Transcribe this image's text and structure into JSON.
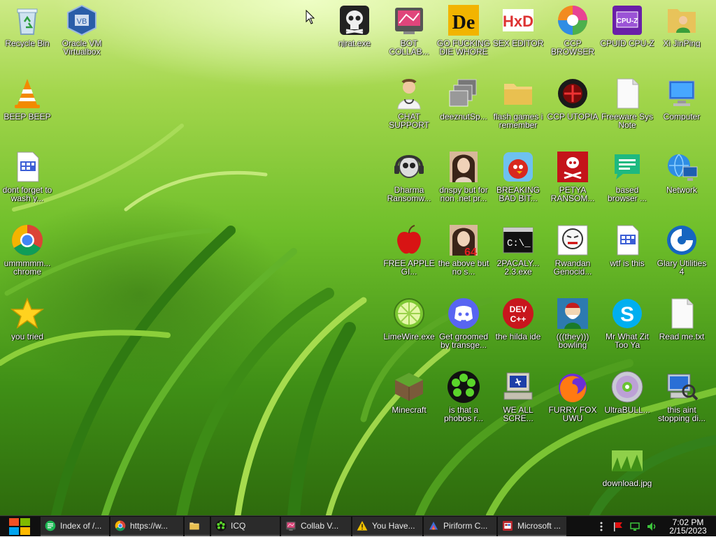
{
  "desktop": {
    "icons": [
      {
        "id": "recycle-bin",
        "label": "Recycle Bin",
        "icon": "recycle-bin-icon"
      },
      {
        "id": "oracle-vm",
        "label": "Oracle VM Virtualbox",
        "icon": "virtualbox-icon"
      },
      {
        "id": "njrat",
        "label": "njrat.exe",
        "icon": "skull-icon"
      },
      {
        "id": "bot-collab",
        "label": "BOT COLLAB...",
        "icon": "bot-collab-icon"
      },
      {
        "id": "go-die",
        "label": "GO FUCKING DIE WHORE",
        "icon": "de-icon"
      },
      {
        "id": "sex-editor",
        "label": "SEX EDITOR",
        "icon": "hxd-icon"
      },
      {
        "id": "ccp-browser",
        "label": "CCP BROWSER",
        "icon": "ccp-browser-icon"
      },
      {
        "id": "cpuid",
        "label": "CPUID CPU-Z",
        "icon": "cpu-z-icon"
      },
      {
        "id": "xi-jinping",
        "label": "Xi JinPing",
        "icon": "user-folder-icon"
      },
      {
        "id": "beep-beep",
        "label": "BEEP BEEP",
        "icon": "vlc-cone-icon"
      },
      {
        "id": "chat-support",
        "label": "CHAT SUPPORT",
        "icon": "doctor-icon"
      },
      {
        "id": "deeznut",
        "label": "deeznutSp...",
        "icon": "stacked-windows-icon"
      },
      {
        "id": "flash-games",
        "label": "flash games i remember",
        "icon": "folder-icon"
      },
      {
        "id": "ccp-utopia",
        "label": "CCP UTOPIA",
        "icon": "utopia-icon"
      },
      {
        "id": "freeware-note",
        "label": "Freeware Sys Note",
        "icon": "blank-document-icon"
      },
      {
        "id": "computer",
        "label": "Computer",
        "icon": "computer-icon"
      },
      {
        "id": "dont-forget",
        "label": "dont forget to wash y...",
        "icon": "document-icon"
      },
      {
        "id": "dharma",
        "label": "Dharma Ransomw...",
        "icon": "skull-headphones-icon"
      },
      {
        "id": "dnspy",
        "label": "dnspy but for non .net pr...",
        "icon": "portrait-icon"
      },
      {
        "id": "breaking-bad",
        "label": "BREAKING BAD BIT...",
        "icon": "angry-bird-icon"
      },
      {
        "id": "petya",
        "label": "PETYA RANSOM...",
        "icon": "petya-skull-icon"
      },
      {
        "id": "based-browser",
        "label": "based browser ...",
        "icon": "chat-bubble-icon"
      },
      {
        "id": "network",
        "label": "Network",
        "icon": "network-icon"
      },
      {
        "id": "chrome",
        "label": "ummmmm... chrome",
        "icon": "chrome-icon"
      },
      {
        "id": "free-apple",
        "label": "FREE APPLE GI...",
        "icon": "apple-icon"
      },
      {
        "id": "the-above",
        "label": "the above but no s...",
        "icon": "portrait-64-icon"
      },
      {
        "id": "2pacaly",
        "label": "2PACALY... 2.3.exe",
        "icon": "console-icon"
      },
      {
        "id": "rwandan",
        "label": "Rwandan Genocid...",
        "icon": "rage-face-icon"
      },
      {
        "id": "wtf-is-this",
        "label": "wtf is this",
        "icon": "document-icon"
      },
      {
        "id": "glary",
        "label": "Glary Utilities 4",
        "icon": "glary-icon"
      },
      {
        "id": "you-tried",
        "label": "you tried",
        "icon": "star-icon"
      },
      {
        "id": "limewire",
        "label": "LimeWire.exe",
        "icon": "limewire-icon"
      },
      {
        "id": "groomed",
        "label": "Get groomed by transge...",
        "icon": "discord-icon"
      },
      {
        "id": "hilda",
        "label": "the hilda ide",
        "icon": "devcpp-icon"
      },
      {
        "id": "they-bowling",
        "label": "(((they))) bowling",
        "icon": "bowling-icon"
      },
      {
        "id": "mr-what",
        "label": "Mr What Zit Too Ya",
        "icon": "skype-icon"
      },
      {
        "id": "readme",
        "label": "Read me.txt",
        "icon": "text-file-icon"
      },
      {
        "id": "minecraft",
        "label": "Minecraft",
        "icon": "minecraft-icon"
      },
      {
        "id": "phobos",
        "label": "is that a phobos r...",
        "icon": "icq-flower-icon"
      },
      {
        "id": "we-all-scream",
        "label": "WE ALL SCRE...",
        "icon": "old-computer-icon"
      },
      {
        "id": "furry-fox",
        "label": "FURRY FOX UWU",
        "icon": "firefox-icon"
      },
      {
        "id": "ultrabull",
        "label": "UltraBULL...",
        "icon": "disc-icon"
      },
      {
        "id": "this-aint",
        "label": "this aint stopping di...",
        "icon": "magnifier-computer-icon"
      },
      {
        "id": "download-jpg",
        "label": "download.jpg",
        "icon": "image-thumbnail-icon"
      }
    ]
  },
  "taskbar": {
    "items": [
      {
        "id": "index-of",
        "label": "Index of /...",
        "icon": "green-chat-icon"
      },
      {
        "id": "chrome-https",
        "label": "https://w...",
        "icon": "chrome-icon"
      },
      {
        "id": "file-explorer",
        "label": "",
        "icon": "folder-icon"
      },
      {
        "id": "icq",
        "label": "ICQ",
        "icon": "icq-flower-icon"
      },
      {
        "id": "collab",
        "label": "Collab V...",
        "icon": "bot-collab-icon"
      },
      {
        "id": "you-have",
        "label": "You Have...",
        "icon": "warning-icon"
      },
      {
        "id": "piriform",
        "label": "Piriform C...",
        "icon": "piriform-icon"
      },
      {
        "id": "microsoft",
        "label": "Microsoft ...",
        "icon": "microsoft-icon"
      }
    ],
    "clock": {
      "time": "7:02 PM",
      "date": "2/15/2023"
    }
  },
  "colors": {
    "taskbar": "#101010",
    "label_text": "#ffffff",
    "desktop_top": "#cdea86",
    "desktop_bottom": "#2e6b0d"
  }
}
